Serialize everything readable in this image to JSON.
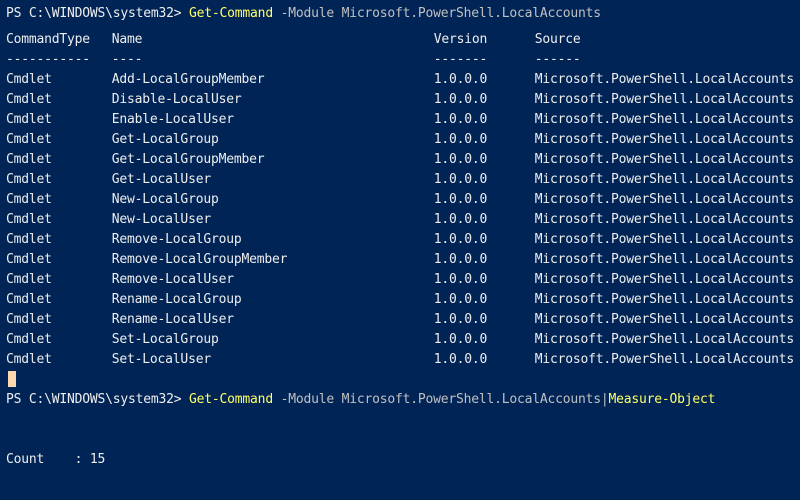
{
  "prompt1": {
    "prefix": "PS C:\\WINDOWS\\system32> ",
    "cmd": "Get-Command",
    "args": " -Module Microsoft.PowerShell.LocalAccounts"
  },
  "table": {
    "headers": [
      "CommandType",
      "Name",
      "Version",
      "Source"
    ],
    "dashes": [
      "-----------",
      "----",
      "-------",
      "------"
    ],
    "rows": [
      [
        "Cmdlet",
        "Add-LocalGroupMember",
        "1.0.0.0",
        "Microsoft.PowerShell.LocalAccounts"
      ],
      [
        "Cmdlet",
        "Disable-LocalUser",
        "1.0.0.0",
        "Microsoft.PowerShell.LocalAccounts"
      ],
      [
        "Cmdlet",
        "Enable-LocalUser",
        "1.0.0.0",
        "Microsoft.PowerShell.LocalAccounts"
      ],
      [
        "Cmdlet",
        "Get-LocalGroup",
        "1.0.0.0",
        "Microsoft.PowerShell.LocalAccounts"
      ],
      [
        "Cmdlet",
        "Get-LocalGroupMember",
        "1.0.0.0",
        "Microsoft.PowerShell.LocalAccounts"
      ],
      [
        "Cmdlet",
        "Get-LocalUser",
        "1.0.0.0",
        "Microsoft.PowerShell.LocalAccounts"
      ],
      [
        "Cmdlet",
        "New-LocalGroup",
        "1.0.0.0",
        "Microsoft.PowerShell.LocalAccounts"
      ],
      [
        "Cmdlet",
        "New-LocalUser",
        "1.0.0.0",
        "Microsoft.PowerShell.LocalAccounts"
      ],
      [
        "Cmdlet",
        "Remove-LocalGroup",
        "1.0.0.0",
        "Microsoft.PowerShell.LocalAccounts"
      ],
      [
        "Cmdlet",
        "Remove-LocalGroupMember",
        "1.0.0.0",
        "Microsoft.PowerShell.LocalAccounts"
      ],
      [
        "Cmdlet",
        "Remove-LocalUser",
        "1.0.0.0",
        "Microsoft.PowerShell.LocalAccounts"
      ],
      [
        "Cmdlet",
        "Rename-LocalGroup",
        "1.0.0.0",
        "Microsoft.PowerShell.LocalAccounts"
      ],
      [
        "Cmdlet",
        "Rename-LocalUser",
        "1.0.0.0",
        "Microsoft.PowerShell.LocalAccounts"
      ],
      [
        "Cmdlet",
        "Set-LocalGroup",
        "1.0.0.0",
        "Microsoft.PowerShell.LocalAccounts"
      ],
      [
        "Cmdlet",
        "Set-LocalUser",
        "1.0.0.0",
        "Microsoft.PowerShell.LocalAccounts"
      ]
    ]
  },
  "prompt2": {
    "prefix": "PS C:\\WINDOWS\\system32> ",
    "cmd": "Get-Command",
    "args_mid": " -Module Microsoft.PowerShell.LocalAccounts|",
    "cmd2": "Measure-Object"
  },
  "result": {
    "label": "Count",
    "colon": "    : ",
    "value": "15"
  }
}
